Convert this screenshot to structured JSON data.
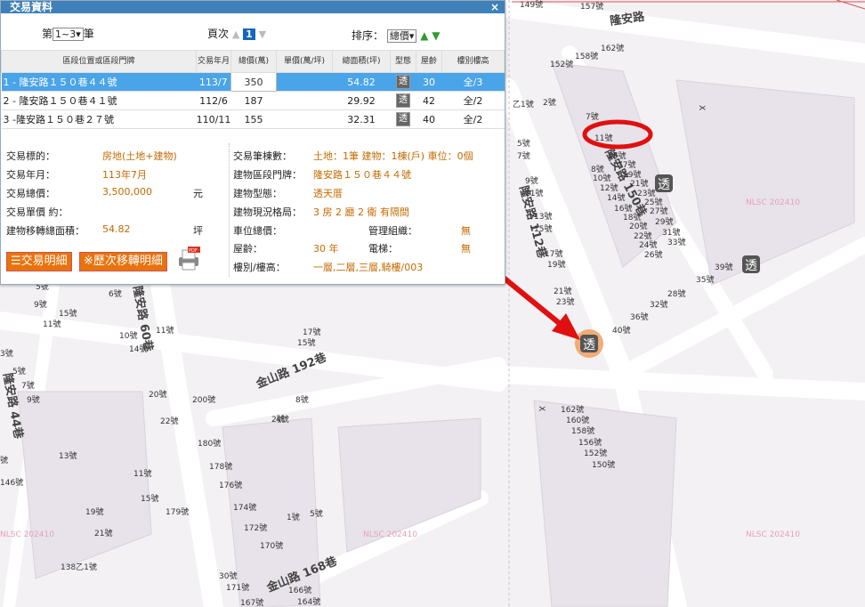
{
  "panel": {
    "title": "交易資料",
    "close_icon": "×"
  },
  "toolbar": {
    "record_prefix": "第",
    "record_range": "1~3",
    "record_suffix": "筆",
    "page_label": "頁次",
    "page_current": "1",
    "sort_label": "排序：",
    "sort_value": "總價"
  },
  "table": {
    "headers": [
      "區段位置或區段門牌",
      "交易年月",
      "總價(萬)",
      "單價(萬/坪)",
      "總面積(坪)",
      "型態",
      "屋齡",
      "樓別樓高"
    ],
    "rows": [
      {
        "addr": "1 - 隆安路１５０巷４４號",
        "date": "113/7",
        "total": "350",
        "unit": "",
        "area": "54.82",
        "type": "透",
        "age": "30",
        "floor": "全/3"
      },
      {
        "addr": "2 - 隆安路１５０巷４１號",
        "date": "112/6",
        "total": "187",
        "unit": "",
        "area": "29.92",
        "type": "透",
        "age": "42",
        "floor": "全/2"
      },
      {
        "addr": "3 -隆安路１５０巷２７號",
        "date": "110/11",
        "total": "155",
        "unit": "",
        "area": "32.31",
        "type": "透",
        "age": "40",
        "floor": "全/2"
      }
    ]
  },
  "detail": {
    "left": [
      {
        "label": "交易標的：",
        "value": "房地(土地+建物)"
      },
      {
        "label": "交易年月：",
        "value": "113年7月"
      },
      {
        "label": "交易總價：",
        "value": "3,500,000",
        "unit": "元"
      },
      {
        "label": "交易單價 約：",
        "value": ""
      },
      {
        "label": "建物移轉總面積：",
        "value": "54.82",
        "unit": "坪"
      }
    ],
    "right": [
      {
        "label": "交易筆棟數：",
        "value": "土地：1筆 建物：1棟(戶) 車位：0個"
      },
      {
        "label": "建物區段門牌：",
        "value": "隆安路１５０巷４４號"
      },
      {
        "label": "建物型態：",
        "value": "透天厝"
      },
      {
        "label": "建物現況格局：",
        "value": "3 房 2 廳 2 衛 有隔間"
      },
      {
        "label": "車位總價：",
        "value": ""
      },
      {
        "label": "屋齡：",
        "value": "30 年"
      },
      {
        "label": "樓別/樓高：",
        "value": "一層,二層,三層,騎樓/003"
      }
    ],
    "mgmt_label": "管理組織：",
    "mgmt_value": "無",
    "elevator_label": "電梯：",
    "elevator_value": "無",
    "btn_detail": "☰交易明細",
    "btn_history": "※歷次移轉明細",
    "pdf_icon": "pdf-printer-icon"
  },
  "map": {
    "roads": [
      "隆安路",
      "隆安路 150巷",
      "隆安路 112巷",
      "隆安路 60巷",
      "隆安路 44巷",
      "金山路 192巷",
      "金山路 168巷"
    ],
    "watermark": "NLSC 202410",
    "marker_label": "透",
    "accent_red": "#e01010",
    "marker_color": "#f0a060"
  }
}
